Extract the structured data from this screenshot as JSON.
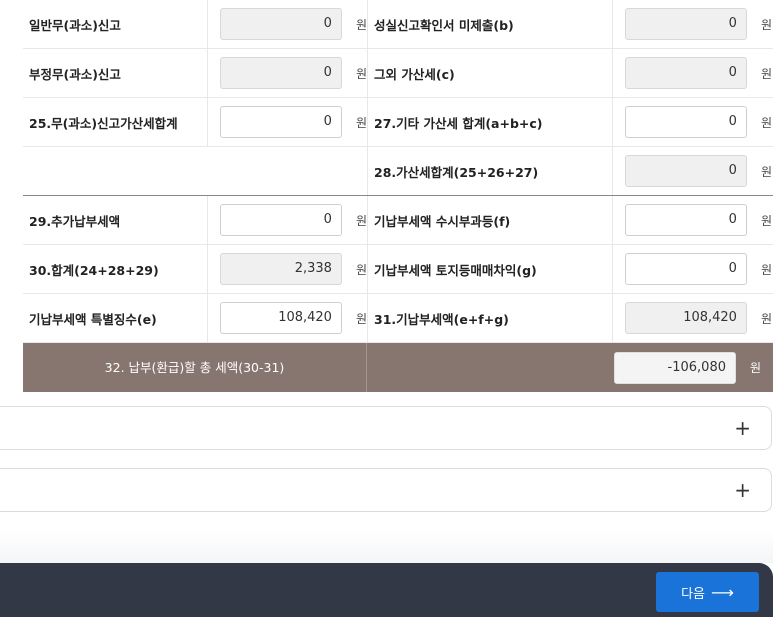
{
  "rows": [
    {
      "left_label": "일반무(과소)신고",
      "left_value": "0",
      "left_readonly": true,
      "right_label": "성실신고확인서 미제출(b)",
      "right_value": "0",
      "right_readonly": true
    },
    {
      "left_label": "부정무(과소)신고",
      "left_value": "0",
      "left_readonly": true,
      "right_label": "그외 가산세(c)",
      "right_value": "0",
      "right_readonly": true
    },
    {
      "left_label": "25.무(과소)신고가산세합계",
      "left_value": "0",
      "left_readonly": false,
      "right_label": "27.기타 가산세 합계(a+b+c)",
      "right_value": "0",
      "right_readonly": false
    },
    {
      "left_label": "",
      "left_value": "",
      "left_readonly": false,
      "right_label": "28.가산세합계(25+26+27)",
      "right_value": "0",
      "right_readonly": true
    },
    {
      "left_label": "29.추가납부세액",
      "left_value": "0",
      "left_readonly": false,
      "right_label": "기납부세액 수시부과등(f)",
      "right_value": "0",
      "right_readonly": false
    },
    {
      "left_label": "30.합계(24+28+29)",
      "left_value": "2,338",
      "left_readonly": true,
      "right_label": "기납부세액 토지등매매차익(g)",
      "right_value": "0",
      "right_readonly": false
    },
    {
      "left_label": "기납부세액 특별징수(e)",
      "left_value": "108,420",
      "left_readonly": false,
      "right_label": "31.기납부세액(e+f+g)",
      "right_value": "108,420",
      "right_readonly": true
    }
  ],
  "unit": "원",
  "total": {
    "label": "32. 납부(환급)할 총 세액(30-31)",
    "value": "-106,080"
  },
  "accordions": [
    {
      "toggle_icon": "+"
    },
    {
      "toggle_icon": "+"
    }
  ],
  "footer": {
    "next_label": "다음",
    "next_arrow": "⟶"
  }
}
